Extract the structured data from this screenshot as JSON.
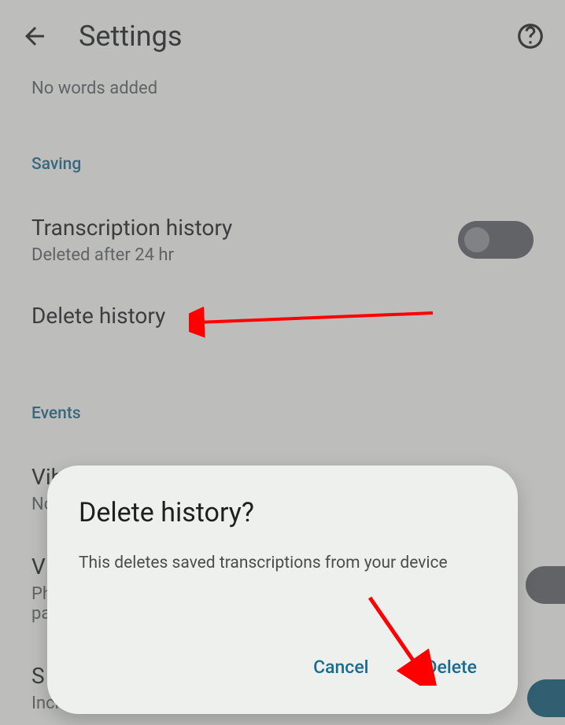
{
  "header": {
    "title": "Settings"
  },
  "noWords": "No words added",
  "sections": {
    "saving": {
      "header": "Saving",
      "transcription": {
        "title": "Transcription history",
        "sub": "Deleted after 24 hr"
      },
      "deleteHistory": {
        "title": "Delete history"
      }
    },
    "events": {
      "header": "Events",
      "vibrate": {
        "title": "Vibrate when name is spoken",
        "sub": "No"
      },
      "item2": {
        "title": "V",
        "sub1": "Ph",
        "sub2": "pa"
      },
      "item3": {
        "title": "S",
        "sub": "Incl"
      }
    }
  },
  "dialog": {
    "title": "Delete history?",
    "body": "This deletes saved transcriptions from your device",
    "cancel": "Cancel",
    "delete": "Delete"
  }
}
